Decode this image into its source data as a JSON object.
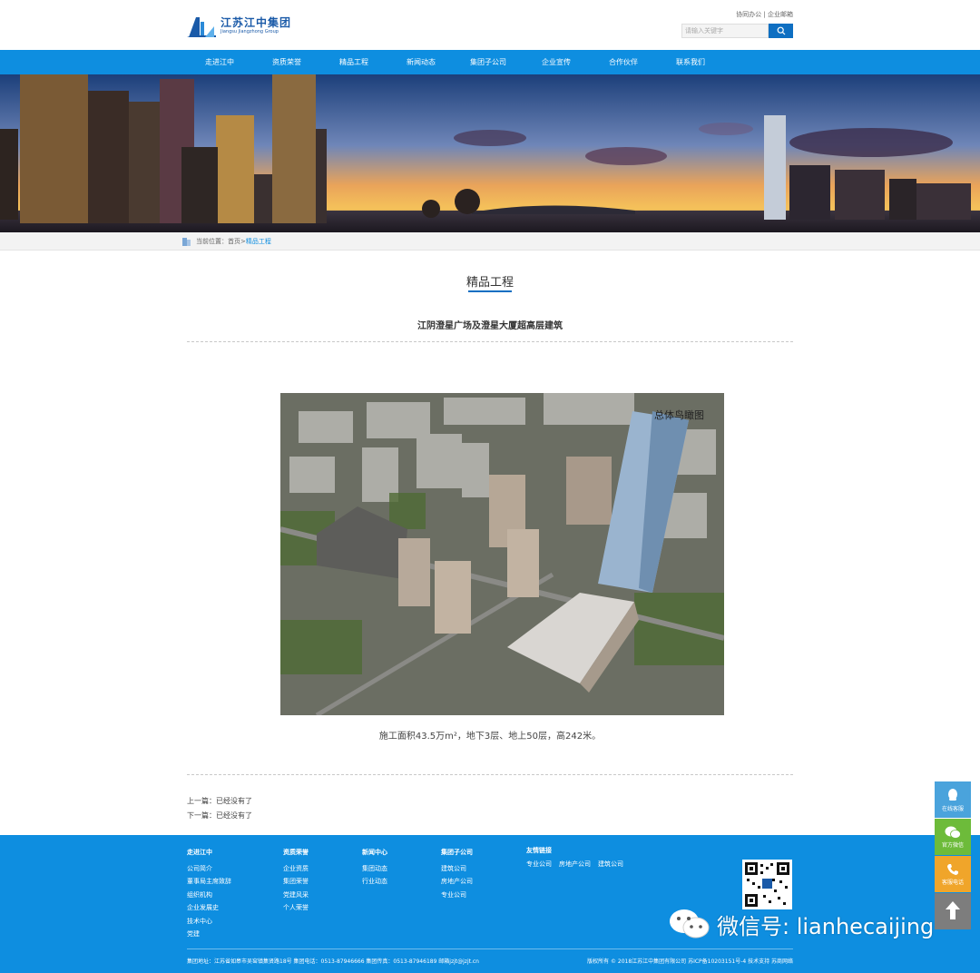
{
  "header": {
    "logo_cn": "江苏江中集团",
    "logo_en": "Jiangsu Jiangzhong Group",
    "top_link_1": "协同办公",
    "top_sep": " | ",
    "top_link_2": "企业邮箱",
    "search_placeholder": "请输入关键字"
  },
  "nav": [
    {
      "label": "走进江中"
    },
    {
      "label": "资质荣誉"
    },
    {
      "label": "精品工程"
    },
    {
      "label": "新闻动态"
    },
    {
      "label": "集团子公司"
    },
    {
      "label": "企业宣传"
    },
    {
      "label": "合作伙伴"
    },
    {
      "label": "联系我们"
    }
  ],
  "breadcrumb": {
    "prefix": "当前位置：",
    "home": "首页",
    "sep": " > ",
    "current": "精品工程"
  },
  "page": {
    "section_title": "精品工程",
    "article_title": "江阴澄星广场及澄星大厦超高层建筑",
    "photo_caption": "总体鸟瞰图",
    "body_text": "施工面积43.5万m²，地下3层、地上50层，高242米。",
    "prev": "上一篇：已经没有了",
    "next": "下一篇：已经没有了"
  },
  "footer": {
    "columns": [
      {
        "head": "走进江中",
        "items": [
          "公司简介",
          "董事局主席致辞",
          "组织机构",
          "企业发展史",
          "技术中心",
          "党建"
        ]
      },
      {
        "head": "资质荣誉",
        "items": [
          "企业资质",
          "集团荣誉",
          "党建风采",
          "个人荣誉"
        ]
      },
      {
        "head": "新闻中心",
        "items": [
          "集团动态",
          "行业动态"
        ]
      },
      {
        "head": "集团子公司",
        "items": [
          "建筑公司",
          "房地产公司",
          "专业公司"
        ]
      }
    ],
    "links_head": "友情链接",
    "links": [
      "专业公司",
      "房地产公司",
      "建筑公司"
    ],
    "address": "集团地址：江苏省如皋市吴窑镇集贤路18号  集团电话：0513-87946666  集团传真：0513-87946189  邮箱jzjt@jzjt.cn",
    "copyright": "版权所有 © 2018江苏江中集团有限公司 苏ICP备10203151号-4 技术支持 苏商网络"
  },
  "watermark": "微信号: lianhecaijing",
  "side": {
    "qq": "在线客服",
    "wechat": "官方微信",
    "phone": "客服电话"
  },
  "colors": {
    "nav_blue": "#0e8ee0",
    "brand_blue": "#0e6fc2",
    "qq_bg": "#4aa3dc",
    "wechat_bg": "#6dbb3a",
    "phone_bg": "#f0a52a",
    "top_bg": "#7d7d7d"
  }
}
